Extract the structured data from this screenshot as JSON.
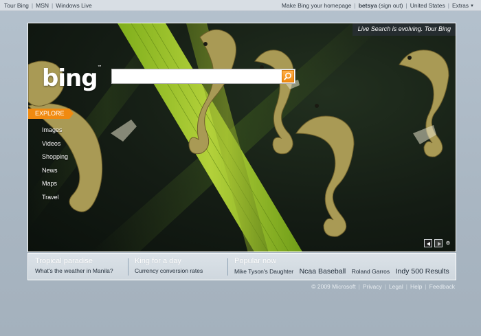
{
  "topbar": {
    "left_links": [
      "Tour Bing",
      "MSN",
      "Windows Live"
    ],
    "homepage_link": "Make Bing your homepage",
    "username": "betsya",
    "signout": "(sign out)",
    "region": "United States",
    "extras": "Extras"
  },
  "hero": {
    "tour_banner": "Live Search is evolving. Tour Bing",
    "logo_text": "bing",
    "logo_tm": "™",
    "search": {
      "value": "",
      "placeholder": ""
    },
    "explore_label": "EXPLORE",
    "nav_items": [
      "Images",
      "Videos",
      "Shopping",
      "News",
      "Maps",
      "Travel"
    ],
    "controls": {
      "prev_icon": "prev-arrow-icon",
      "next_icon": "next-arrow-icon",
      "info_icon": "info-icon"
    }
  },
  "panel": {
    "col1": {
      "heading": "Tropical paradise",
      "sub": "What's the weather in Manila?"
    },
    "col2": {
      "heading": "King for a day",
      "sub": "Currency conversion rates"
    },
    "col3": {
      "heading": "Popular now",
      "items": [
        {
          "text": "Mike Tyson's Daughter",
          "size": "small"
        },
        {
          "text": "Ncaa Baseball",
          "size": "large"
        },
        {
          "text": "Roland Garros",
          "size": "small"
        },
        {
          "text": "Indy 500 Results",
          "size": "large"
        }
      ]
    }
  },
  "footer": {
    "copyright": "© 2009 Microsoft",
    "links": [
      "Privacy",
      "Legal",
      "Help",
      "Feedback"
    ]
  },
  "colors": {
    "accent": "#f08a10",
    "page_bg": "#aab7c3",
    "panel_bg": "#d6dde3"
  }
}
